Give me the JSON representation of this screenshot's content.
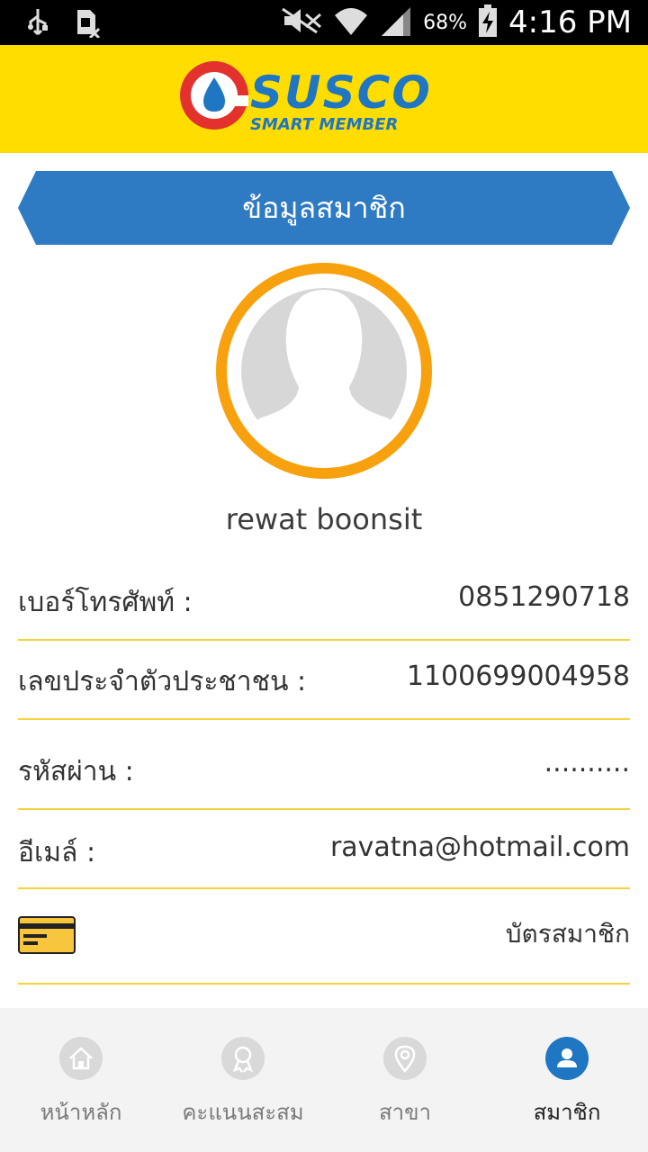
{
  "status_bar": {
    "battery_percent": "68%",
    "time": "4:16 PM",
    "icons": [
      "usb-icon",
      "sim-missing-icon",
      "mute-icon",
      "wifi-icon",
      "signal-icon",
      "battery-charging-icon"
    ]
  },
  "header": {
    "logo_text": "SUSCO",
    "logo_subtext": "SMART MEMBER"
  },
  "page": {
    "title": "ข้อมูลสมาชิก"
  },
  "profile": {
    "name": "rewat boonsit"
  },
  "fields": {
    "phone_label": "เบอร์โทรศัพท์ :",
    "phone_value": "0851290718",
    "id_label": "เลขประจำตัวประชาชน :",
    "id_value": "1100699004958",
    "password_label": "รหัสผ่าน :",
    "password_value": "..........",
    "email_label": "อีเมล์ :",
    "email_value": "ravatna@hotmail.com",
    "member_card_label": "บัตรสมาชิก"
  },
  "bottom_nav": {
    "items": [
      {
        "label": "หน้าหลัก",
        "icon": "home-icon"
      },
      {
        "label": "คะแนนสะสม",
        "icon": "award-icon"
      },
      {
        "label": "สาขา",
        "icon": "location-pin-icon"
      },
      {
        "label": "สมาชิก",
        "icon": "user-icon"
      }
    ],
    "active_index": 3
  },
  "colors": {
    "header_yellow": "#ffdd00",
    "banner_blue": "#2f7bc3",
    "avatar_ring": "#f7a10e",
    "divider": "#f5d23a",
    "active_nav": "#1f76c2"
  }
}
